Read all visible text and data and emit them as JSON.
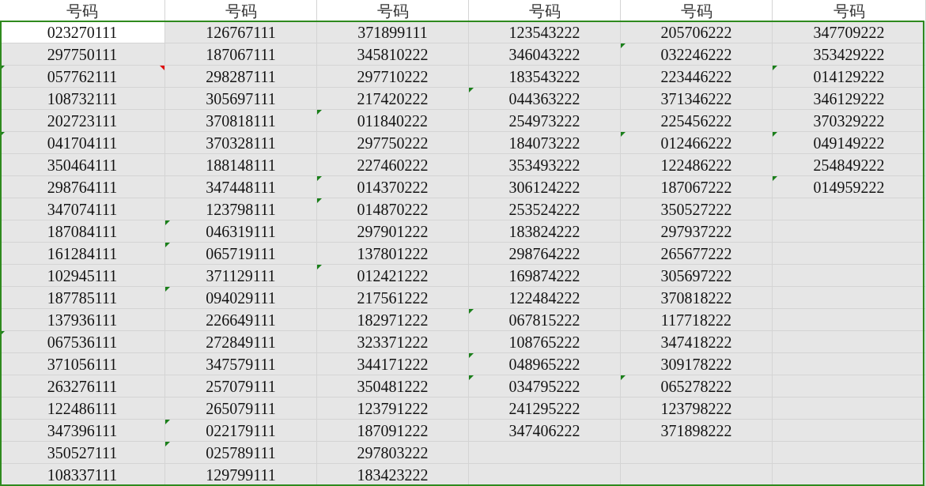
{
  "sheet": {
    "columns": [
      {
        "header": "号码",
        "cells": [
          {
            "text": "023270111",
            "warning": false,
            "comment": false,
            "active": true
          },
          {
            "text": "297750111",
            "warning": false,
            "comment": false,
            "active": false
          },
          {
            "text": "057762111",
            "warning": true,
            "comment": true,
            "active": false
          },
          {
            "text": "108732111",
            "warning": false,
            "comment": false,
            "active": false
          },
          {
            "text": "202723111",
            "warning": false,
            "comment": false,
            "active": false
          },
          {
            "text": "041704111",
            "warning": true,
            "comment": false,
            "active": false
          },
          {
            "text": "350464111",
            "warning": false,
            "comment": false,
            "active": false
          },
          {
            "text": "298764111",
            "warning": false,
            "comment": false,
            "active": false
          },
          {
            "text": "347074111",
            "warning": false,
            "comment": false,
            "active": false
          },
          {
            "text": "187084111",
            "warning": false,
            "comment": false,
            "active": false
          },
          {
            "text": "161284111",
            "warning": false,
            "comment": false,
            "active": false
          },
          {
            "text": "102945111",
            "warning": false,
            "comment": false,
            "active": false
          },
          {
            "text": "187785111",
            "warning": false,
            "comment": false,
            "active": false
          },
          {
            "text": "137936111",
            "warning": false,
            "comment": false,
            "active": false
          },
          {
            "text": "067536111",
            "warning": true,
            "comment": false,
            "active": false
          },
          {
            "text": "371056111",
            "warning": false,
            "comment": false,
            "active": false
          },
          {
            "text": "263276111",
            "warning": false,
            "comment": false,
            "active": false
          },
          {
            "text": "122486111",
            "warning": false,
            "comment": false,
            "active": false
          },
          {
            "text": "347396111",
            "warning": false,
            "comment": false,
            "active": false
          },
          {
            "text": "350527111",
            "warning": false,
            "comment": false,
            "active": false
          },
          {
            "text": "108337111",
            "warning": false,
            "comment": false,
            "active": false
          }
        ]
      },
      {
        "header": "号码",
        "cells": [
          {
            "text": "126767111",
            "warning": false,
            "comment": false,
            "active": false
          },
          {
            "text": "187067111",
            "warning": false,
            "comment": false,
            "active": false
          },
          {
            "text": "298287111",
            "warning": false,
            "comment": false,
            "active": false
          },
          {
            "text": "305697111",
            "warning": false,
            "comment": false,
            "active": false
          },
          {
            "text": "370818111",
            "warning": false,
            "comment": false,
            "active": false
          },
          {
            "text": "370328111",
            "warning": false,
            "comment": false,
            "active": false
          },
          {
            "text": "188148111",
            "warning": false,
            "comment": false,
            "active": false
          },
          {
            "text": "347448111",
            "warning": false,
            "comment": false,
            "active": false
          },
          {
            "text": "123798111",
            "warning": false,
            "comment": false,
            "active": false
          },
          {
            "text": "046319111",
            "warning": true,
            "comment": false,
            "active": false
          },
          {
            "text": "065719111",
            "warning": true,
            "comment": false,
            "active": false
          },
          {
            "text": "371129111",
            "warning": false,
            "comment": false,
            "active": false
          },
          {
            "text": "094029111",
            "warning": true,
            "comment": false,
            "active": false
          },
          {
            "text": "226649111",
            "warning": false,
            "comment": false,
            "active": false
          },
          {
            "text": "272849111",
            "warning": false,
            "comment": false,
            "active": false
          },
          {
            "text": "347579111",
            "warning": false,
            "comment": false,
            "active": false
          },
          {
            "text": "257079111",
            "warning": false,
            "comment": false,
            "active": false
          },
          {
            "text": "265079111",
            "warning": false,
            "comment": false,
            "active": false
          },
          {
            "text": "022179111",
            "warning": true,
            "comment": false,
            "active": false
          },
          {
            "text": "025789111",
            "warning": true,
            "comment": false,
            "active": false
          },
          {
            "text": "129799111",
            "warning": false,
            "comment": false,
            "active": false
          }
        ]
      },
      {
        "header": "号码",
        "cells": [
          {
            "text": "371899111",
            "warning": false,
            "comment": false,
            "active": false
          },
          {
            "text": "345810222",
            "warning": false,
            "comment": false,
            "active": false
          },
          {
            "text": "297710222",
            "warning": false,
            "comment": false,
            "active": false
          },
          {
            "text": "217420222",
            "warning": false,
            "comment": false,
            "active": false
          },
          {
            "text": "011840222",
            "warning": true,
            "comment": false,
            "active": false
          },
          {
            "text": "297750222",
            "warning": false,
            "comment": false,
            "active": false
          },
          {
            "text": "227460222",
            "warning": false,
            "comment": false,
            "active": false
          },
          {
            "text": "014370222",
            "warning": true,
            "comment": false,
            "active": false
          },
          {
            "text": "014870222",
            "warning": true,
            "comment": false,
            "active": false
          },
          {
            "text": "297901222",
            "warning": false,
            "comment": false,
            "active": false
          },
          {
            "text": "137801222",
            "warning": false,
            "comment": false,
            "active": false
          },
          {
            "text": "012421222",
            "warning": true,
            "comment": false,
            "active": false
          },
          {
            "text": "217561222",
            "warning": false,
            "comment": false,
            "active": false
          },
          {
            "text": "182971222",
            "warning": false,
            "comment": false,
            "active": false
          },
          {
            "text": "323371222",
            "warning": false,
            "comment": false,
            "active": false
          },
          {
            "text": "344171222",
            "warning": false,
            "comment": false,
            "active": false
          },
          {
            "text": "350481222",
            "warning": false,
            "comment": false,
            "active": false
          },
          {
            "text": "123791222",
            "warning": false,
            "comment": false,
            "active": false
          },
          {
            "text": "187091222",
            "warning": false,
            "comment": false,
            "active": false
          },
          {
            "text": "297803222",
            "warning": false,
            "comment": false,
            "active": false
          },
          {
            "text": "183423222",
            "warning": false,
            "comment": false,
            "active": false
          }
        ]
      },
      {
        "header": "号码",
        "cells": [
          {
            "text": "123543222",
            "warning": false,
            "comment": false,
            "active": false
          },
          {
            "text": "346043222",
            "warning": false,
            "comment": false,
            "active": false
          },
          {
            "text": "183543222",
            "warning": false,
            "comment": false,
            "active": false
          },
          {
            "text": "044363222",
            "warning": true,
            "comment": false,
            "active": false
          },
          {
            "text": "254973222",
            "warning": false,
            "comment": false,
            "active": false
          },
          {
            "text": "184073222",
            "warning": false,
            "comment": false,
            "active": false
          },
          {
            "text": "353493222",
            "warning": false,
            "comment": false,
            "active": false
          },
          {
            "text": "306124222",
            "warning": false,
            "comment": false,
            "active": false
          },
          {
            "text": "253524222",
            "warning": false,
            "comment": false,
            "active": false
          },
          {
            "text": "183824222",
            "warning": false,
            "comment": false,
            "active": false
          },
          {
            "text": "298764222",
            "warning": false,
            "comment": false,
            "active": false
          },
          {
            "text": "169874222",
            "warning": false,
            "comment": false,
            "active": false
          },
          {
            "text": "122484222",
            "warning": false,
            "comment": false,
            "active": false
          },
          {
            "text": "067815222",
            "warning": true,
            "comment": false,
            "active": false
          },
          {
            "text": "108765222",
            "warning": false,
            "comment": false,
            "active": false
          },
          {
            "text": "048965222",
            "warning": true,
            "comment": false,
            "active": false
          },
          {
            "text": "034795222",
            "warning": true,
            "comment": false,
            "active": false
          },
          {
            "text": "241295222",
            "warning": false,
            "comment": false,
            "active": false
          },
          {
            "text": "347406222",
            "warning": false,
            "comment": false,
            "active": false
          }
        ]
      },
      {
        "header": "号码",
        "cells": [
          {
            "text": "205706222",
            "warning": false,
            "comment": false,
            "active": false
          },
          {
            "text": "032246222",
            "warning": true,
            "comment": false,
            "active": false
          },
          {
            "text": "223446222",
            "warning": false,
            "comment": false,
            "active": false
          },
          {
            "text": "371346222",
            "warning": false,
            "comment": false,
            "active": false
          },
          {
            "text": "225456222",
            "warning": false,
            "comment": false,
            "active": false
          },
          {
            "text": "012466222",
            "warning": true,
            "comment": false,
            "active": false
          },
          {
            "text": "122486222",
            "warning": false,
            "comment": false,
            "active": false
          },
          {
            "text": "187067222",
            "warning": false,
            "comment": false,
            "active": false
          },
          {
            "text": "350527222",
            "warning": false,
            "comment": false,
            "active": false
          },
          {
            "text": "297937222",
            "warning": false,
            "comment": false,
            "active": false
          },
          {
            "text": "265677222",
            "warning": false,
            "comment": false,
            "active": false
          },
          {
            "text": "305697222",
            "warning": false,
            "comment": false,
            "active": false
          },
          {
            "text": "370818222",
            "warning": false,
            "comment": false,
            "active": false
          },
          {
            "text": "117718222",
            "warning": false,
            "comment": false,
            "active": false
          },
          {
            "text": "347418222",
            "warning": false,
            "comment": false,
            "active": false
          },
          {
            "text": "309178222",
            "warning": false,
            "comment": false,
            "active": false
          },
          {
            "text": "065278222",
            "warning": true,
            "comment": false,
            "active": false
          },
          {
            "text": "123798222",
            "warning": false,
            "comment": false,
            "active": false
          },
          {
            "text": "371898222",
            "warning": false,
            "comment": false,
            "active": false
          }
        ]
      },
      {
        "header": "号码",
        "cells": [
          {
            "text": "347709222",
            "warning": false,
            "comment": false,
            "active": false
          },
          {
            "text": "353429222",
            "warning": false,
            "comment": false,
            "active": false
          },
          {
            "text": "014129222",
            "warning": true,
            "comment": false,
            "active": false
          },
          {
            "text": "346129222",
            "warning": false,
            "comment": false,
            "active": false
          },
          {
            "text": "370329222",
            "warning": false,
            "comment": false,
            "active": false
          },
          {
            "text": "049149222",
            "warning": true,
            "comment": false,
            "active": false
          },
          {
            "text": "254849222",
            "warning": false,
            "comment": false,
            "active": false
          },
          {
            "text": "014959222",
            "warning": true,
            "comment": false,
            "active": false
          }
        ]
      }
    ]
  }
}
